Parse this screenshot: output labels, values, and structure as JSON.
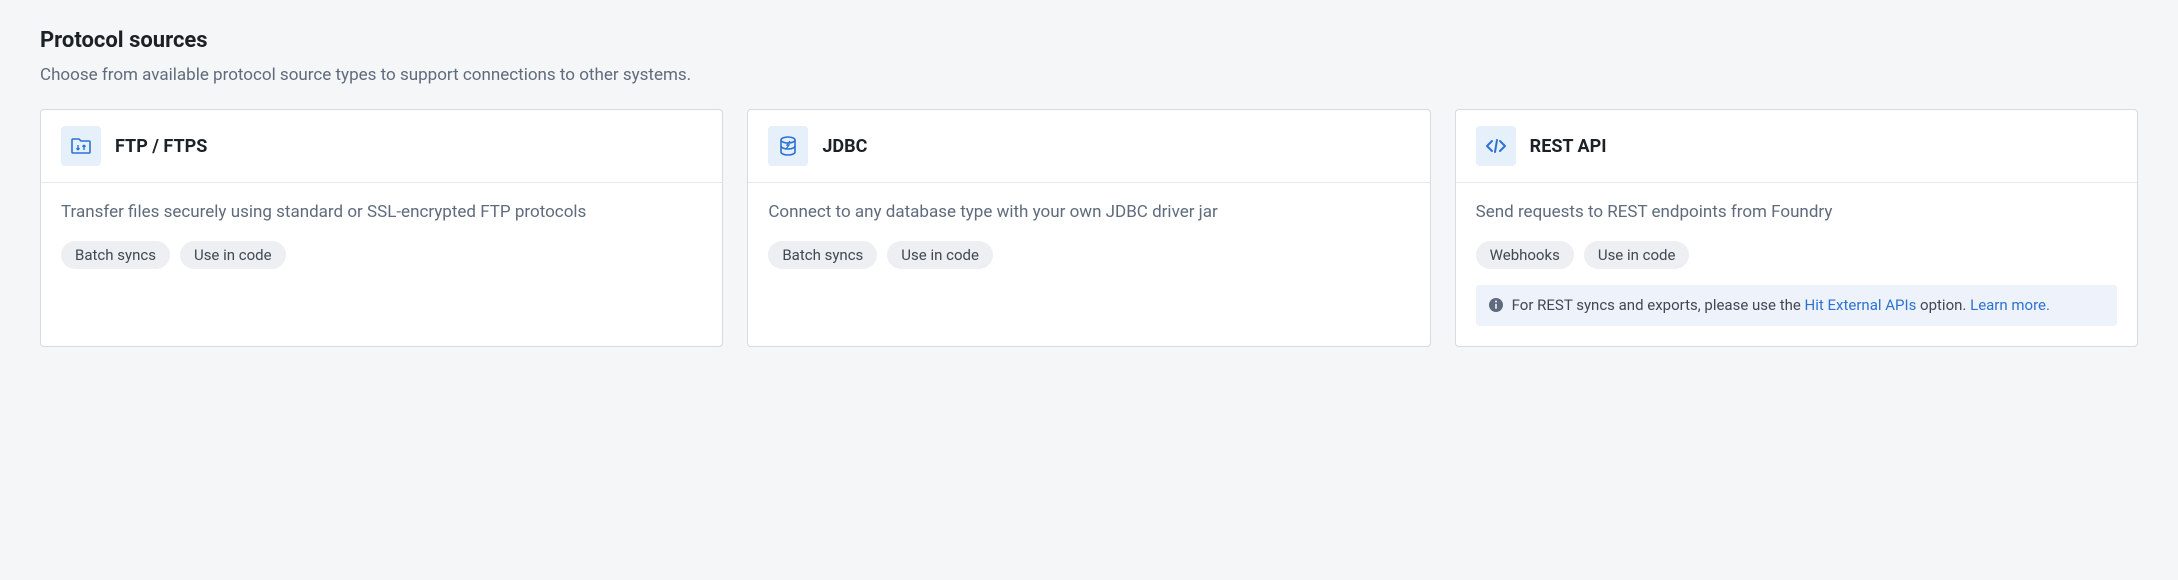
{
  "section": {
    "title": "Protocol sources",
    "subtitle": "Choose from available protocol source types to support connections to other systems."
  },
  "cards": [
    {
      "icon": "folder-transfer-icon",
      "title": "FTP / FTPS",
      "description": "Transfer files securely using standard or SSL-encrypted FTP protocols",
      "tags": [
        "Batch syncs",
        "Use in code"
      ]
    },
    {
      "icon": "database-icon",
      "title": "JDBC",
      "description": "Connect to any database type with your own JDBC driver jar",
      "tags": [
        "Batch syncs",
        "Use in code"
      ]
    },
    {
      "icon": "code-icon",
      "title": "REST API",
      "description": "Send requests to REST endpoints from Foundry",
      "tags": [
        "Webhooks",
        "Use in code"
      ],
      "info": {
        "prefix": "For REST syncs and exports, please use the ",
        "link1": "Hit External APIs",
        "middle": " option. ",
        "link2": "Learn more."
      }
    }
  ]
}
